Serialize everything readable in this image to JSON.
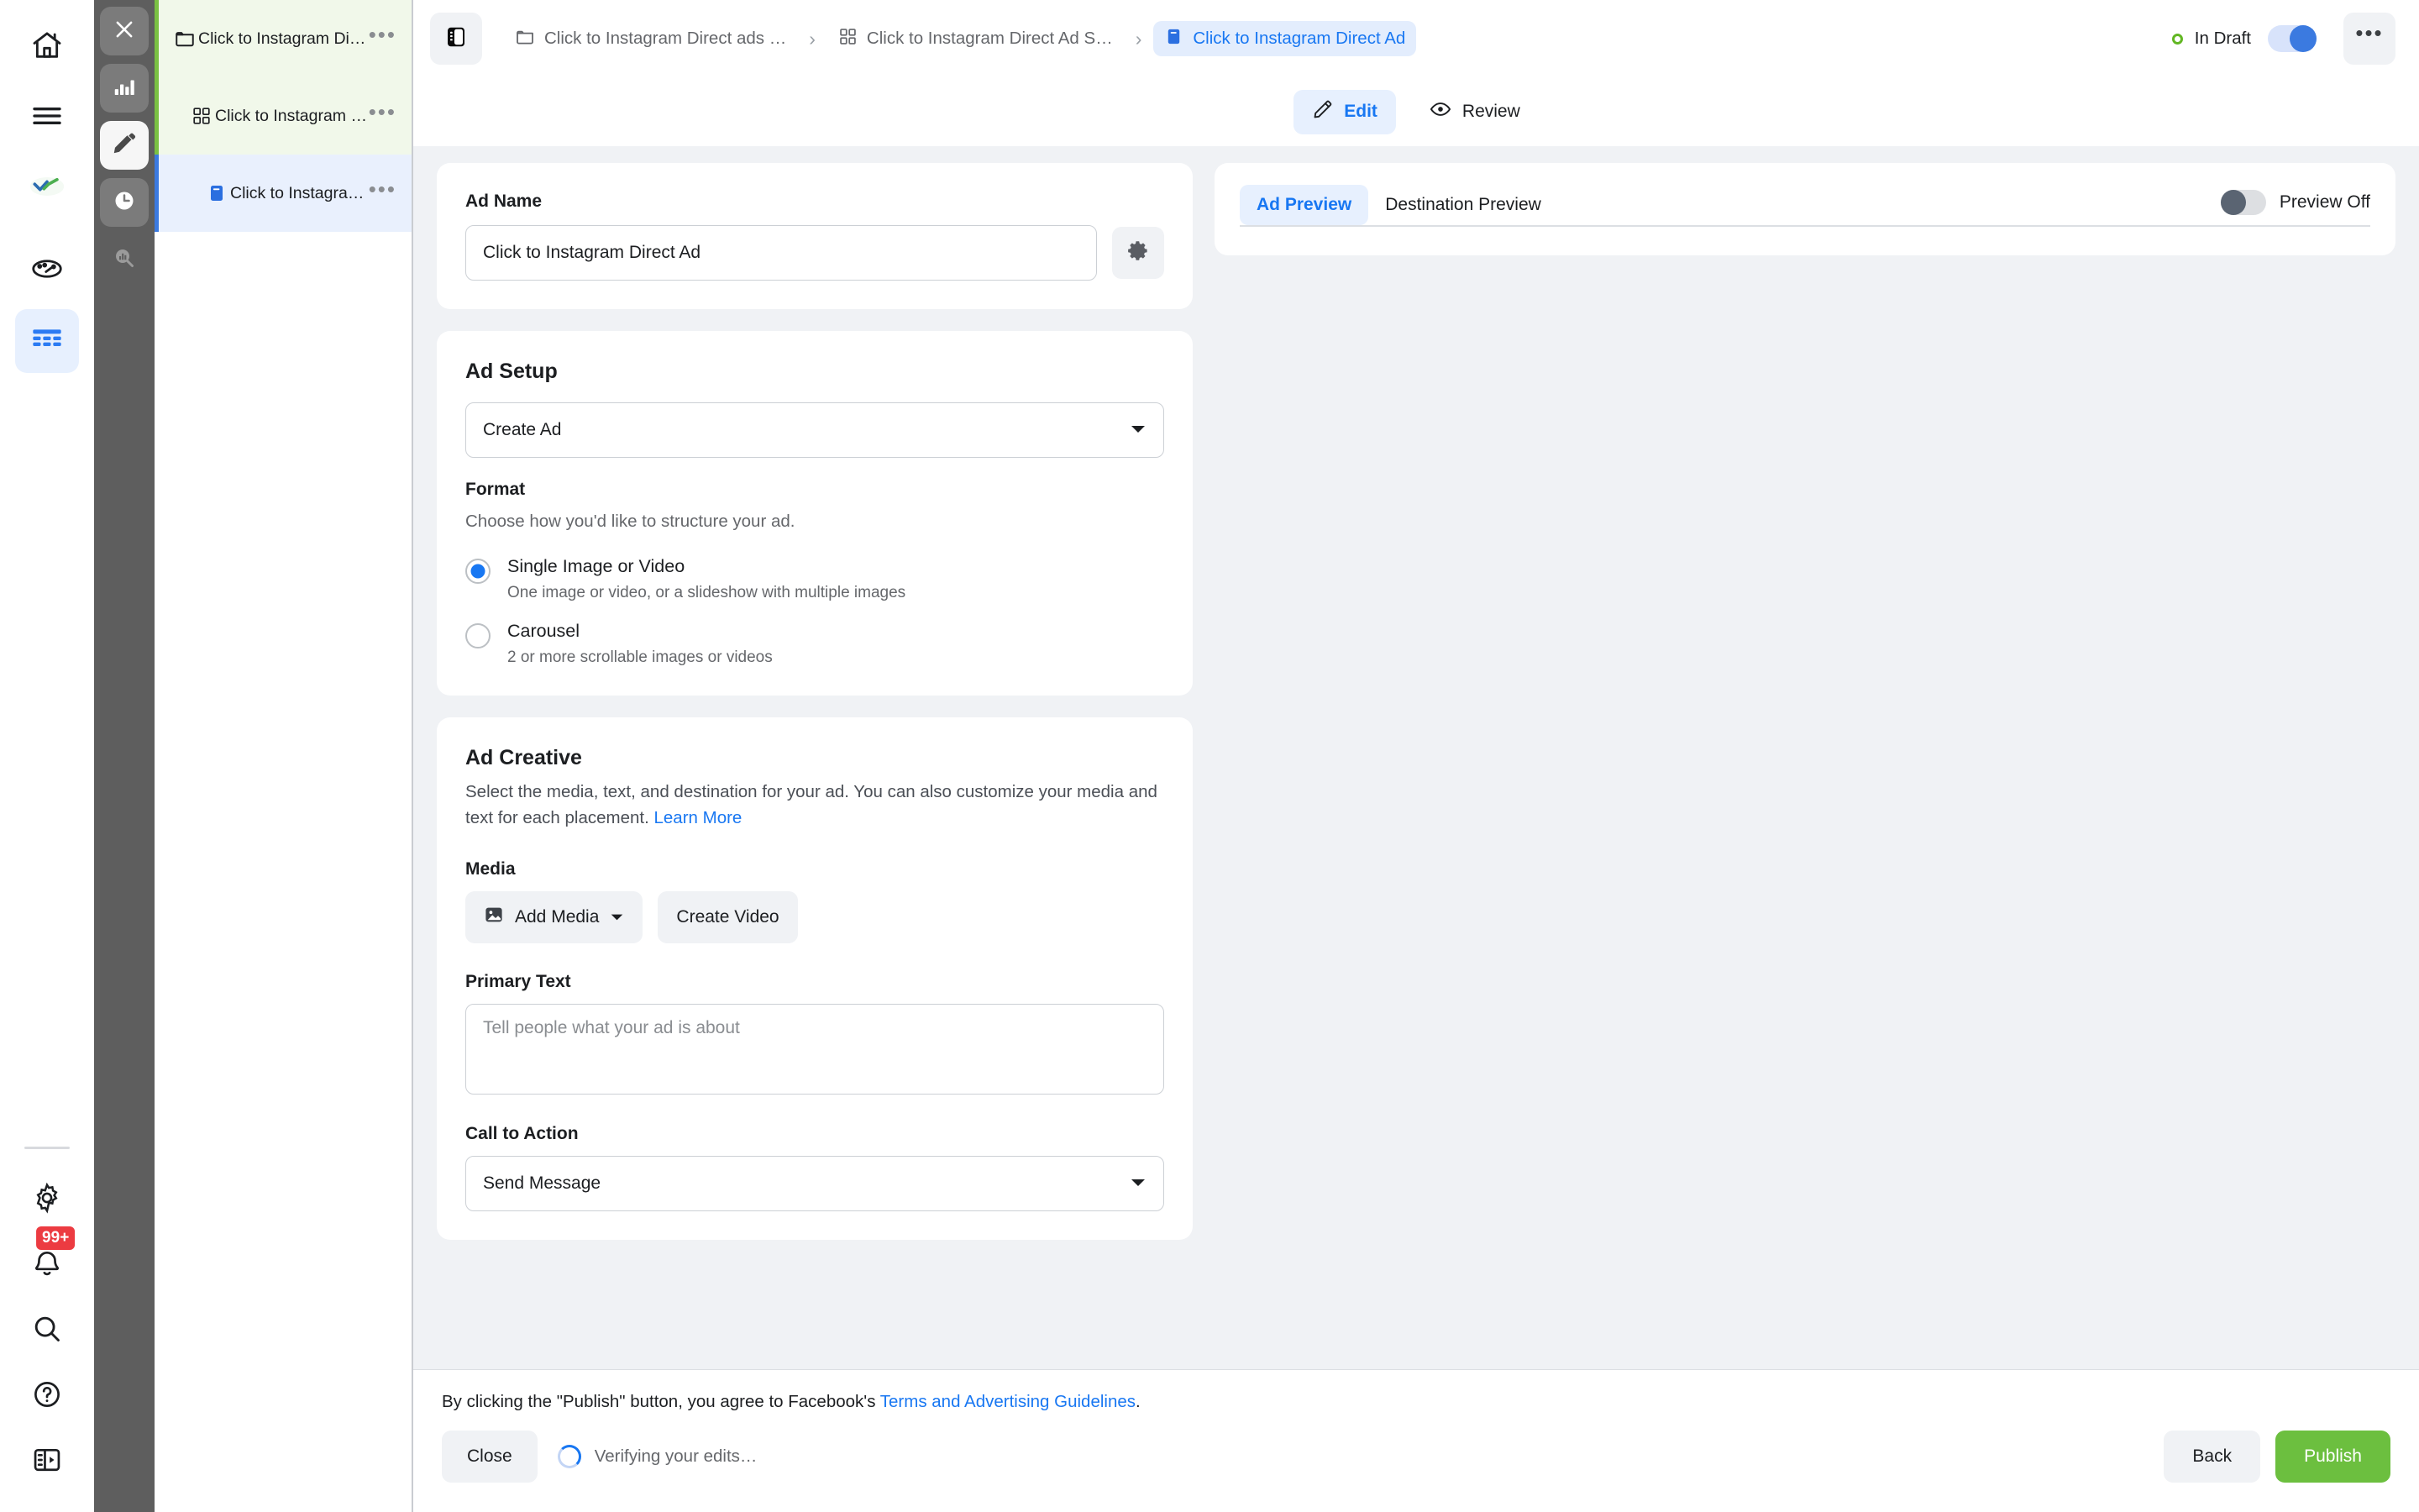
{
  "rail": {
    "top_items": [
      {
        "name": "home-icon",
        "label": "Home"
      },
      {
        "name": "menu-icon",
        "label": "Menu"
      },
      {
        "name": "brand-logo-icon",
        "label": "Brand"
      },
      {
        "name": "dashboard-icon",
        "label": "Dashboard"
      },
      {
        "name": "table-icon",
        "label": "Table",
        "active": true
      }
    ],
    "bottom_items": [
      {
        "name": "gear-icon",
        "label": "Settings"
      },
      {
        "name": "bell-icon",
        "label": "Notifications",
        "badge": "99+"
      },
      {
        "name": "search-icon",
        "label": "Search"
      },
      {
        "name": "help-icon",
        "label": "Help"
      },
      {
        "name": "panel-collapse-icon",
        "label": "Collapse panel"
      }
    ]
  },
  "darkrail": {
    "items": [
      {
        "name": "close-icon",
        "label": "Close"
      },
      {
        "name": "bar-chart-icon",
        "label": "Charts"
      },
      {
        "name": "pencil-icon",
        "label": "Edit",
        "active": true
      },
      {
        "name": "clock-icon",
        "label": "History"
      },
      {
        "name": "chart-search-icon",
        "label": "Inspect"
      }
    ]
  },
  "tree": {
    "rows": [
      {
        "icon": "folder-icon",
        "label": "Click to Instagram Direct ads Campaign",
        "state": "green",
        "indent": 0,
        "menu": "•••"
      },
      {
        "icon": "grid-icon",
        "label": "Click to Instagram Direct Ad Set",
        "state": "green",
        "indent": 1,
        "menu": "•••"
      },
      {
        "icon": "ad-icon",
        "label": "Click to Instagram Direct Ad",
        "state": "blue",
        "indent": 2,
        "menu": "•••"
      }
    ]
  },
  "header": {
    "panel_toggle_icon": "panel-toggle-icon",
    "breadcrumbs": [
      {
        "icon": "folder-icon",
        "label": "Click to Instagram Direct ads …",
        "current": false
      },
      {
        "icon": "grid-icon",
        "label": "Click to Instagram Direct Ad S…",
        "current": false
      },
      {
        "icon": "ad-icon",
        "label": "Click to Instagram Direct Ad",
        "current": true
      }
    ],
    "separator": "›",
    "status_label": "In Draft",
    "status_color": "#62b723",
    "toggle_on": true,
    "more_label": "•••"
  },
  "tabs": [
    {
      "name": "tab-edit",
      "icon": "pencil-icon",
      "label": "Edit",
      "active": true
    },
    {
      "name": "tab-review",
      "icon": "eye-icon",
      "label": "Review",
      "active": false
    }
  ],
  "ad_name": {
    "label": "Ad Name",
    "value": "Click to Instagram Direct Ad",
    "placeholder": "Ad Name",
    "settings_icon": "gear-icon"
  },
  "ad_setup": {
    "title": "Ad Setup",
    "select_value": "Create Ad",
    "format_label": "Format",
    "format_help": "Choose how you'd like to structure your ad.",
    "options": [
      {
        "title": "Single Image or Video",
        "desc": "One image or video, or a slideshow with multiple images",
        "selected": true
      },
      {
        "title": "Carousel",
        "desc": "2 or more scrollable images or videos",
        "selected": false
      }
    ]
  },
  "ad_creative": {
    "title": "Ad Creative",
    "desc_part1": "Select the media, text, and destination for your ad. You can also customize your media and text for each placement. ",
    "learn_more": "Learn More",
    "media_label": "Media",
    "add_media_label": "Add Media",
    "create_video_label": "Create Video",
    "primary_text_label": "Primary Text",
    "primary_text_value": "",
    "primary_text_placeholder": "Tell people what your ad is about",
    "cta_label": "Call to Action",
    "cta_value": "Send Message"
  },
  "preview": {
    "tabs": [
      {
        "label": "Ad Preview",
        "active": true
      },
      {
        "label": "Destination Preview",
        "active": false
      }
    ],
    "toggle_label": "Preview Off",
    "toggle_on": false
  },
  "footer": {
    "terms_prefix": "By clicking the \"Publish\" button, you agree to Facebook's ",
    "terms_link": "Terms and Advertising Guidelines",
    "terms_suffix": ".",
    "close_label": "Close",
    "verifying_label": "Verifying your edits…",
    "back_label": "Back",
    "publish_label": "Publish",
    "publish_color": "#6cbf3f"
  },
  "colors": {
    "accent_blue": "#1877f2",
    "green_row": "#f1f8ea",
    "green_bar": "#7ac143",
    "blue_row": "#e9f0fd",
    "blue_bar": "#3b7ae0",
    "content_bg": "#f0f2f5",
    "dark_rail": "#5e5e5e"
  }
}
